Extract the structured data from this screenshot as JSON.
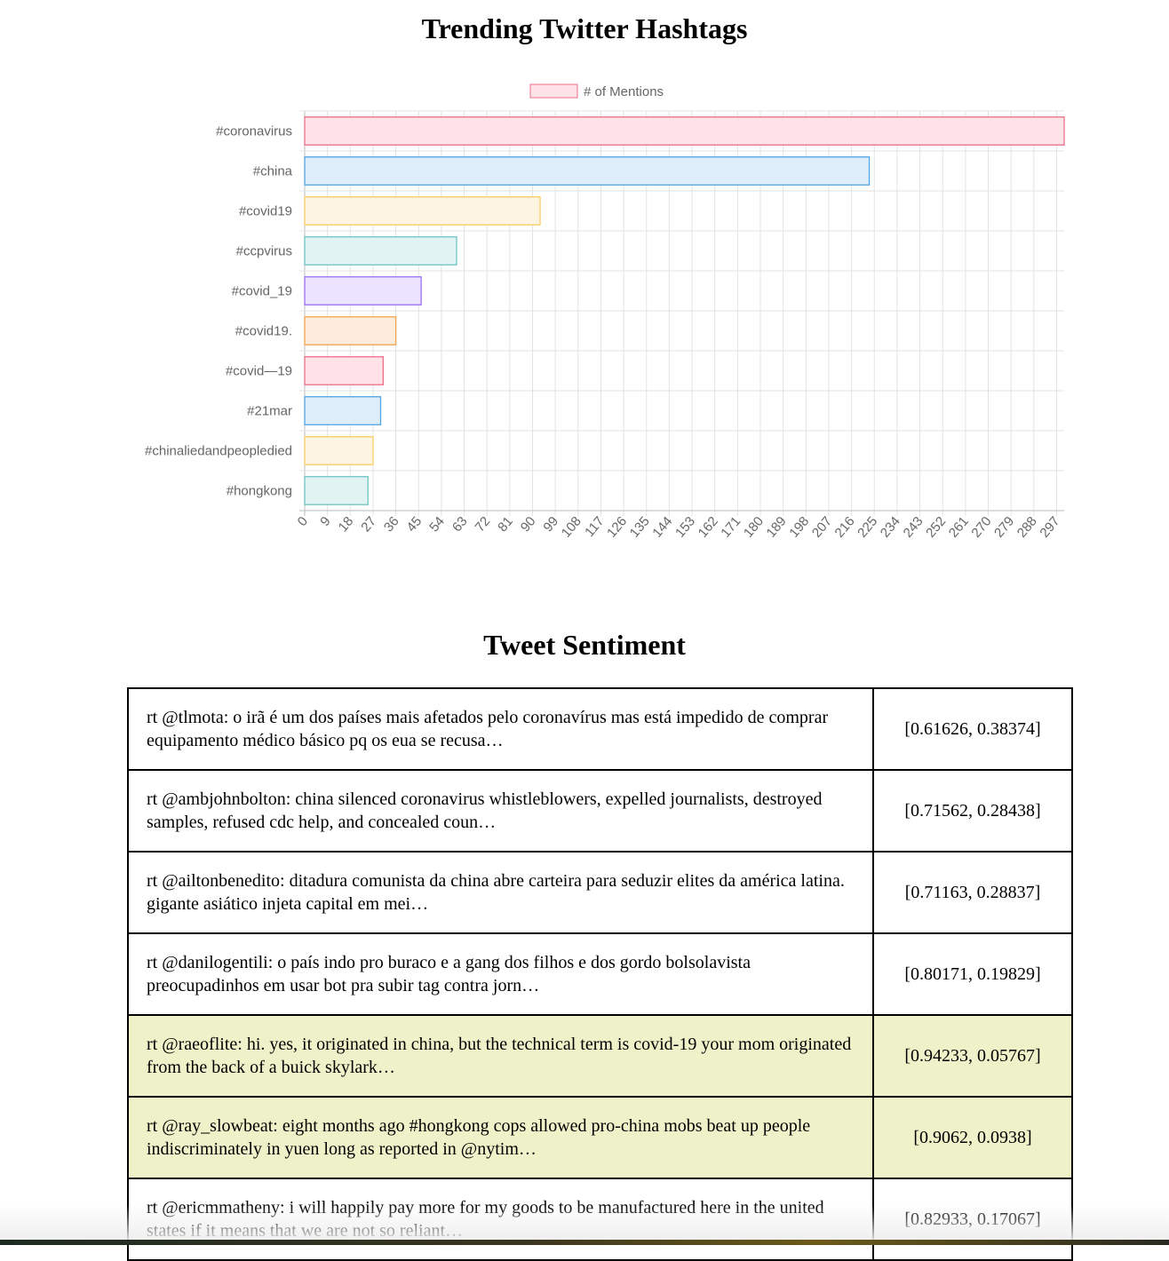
{
  "chart_title": "Trending Twitter Hashtags",
  "chart_data": {
    "type": "bar",
    "orientation": "horizontal",
    "title": "Trending Twitter Hashtags",
    "legend": {
      "label": "# of Mentions",
      "position": "top"
    },
    "categories": [
      "#coronavirus",
      "#china",
      "#covid19",
      "#ccpvirus",
      "#covid_19",
      "#covid19.",
      "#covid—19",
      "#21mar",
      "#chinaliedandpeopledied",
      "#hongkong"
    ],
    "series": [
      {
        "name": "# of Mentions",
        "values": [
          300,
          223,
          93,
          60,
          46,
          36,
          31,
          30,
          27,
          25
        ]
      }
    ],
    "xlim": [
      0,
      300
    ],
    "x_ticks": [
      "0",
      "9",
      "18",
      "27",
      "36",
      "45",
      "54",
      "63",
      "72",
      "81",
      "90",
      "99",
      "108",
      "117",
      "126",
      "135",
      "144",
      "153",
      "162",
      "171",
      "180",
      "189",
      "198",
      "207",
      "216",
      "225",
      "234",
      "243",
      "252",
      "261",
      "270",
      "279",
      "288",
      "297"
    ],
    "grid": true,
    "colors": {
      "fills": [
        "#fde3e8",
        "#deedfa",
        "#fdf4e2",
        "#e1f3f3",
        "#ebe3ff",
        "#fdebdc",
        "#fde3e8",
        "#deedfa",
        "#fdf4e2",
        "#e1f3f3"
      ],
      "strokes": [
        "#ec6f88",
        "#52a4e3",
        "#f9ce63",
        "#6fc3c3",
        "#9b6ff0",
        "#f6a34d",
        "#ec6f88",
        "#52a4e3",
        "#f9ce63",
        "#6fc3c3"
      ]
    }
  },
  "sentiment": {
    "title": "Tweet Sentiment",
    "rows": [
      {
        "text": "rt @tlmota: o irã é um dos países mais afetados pelo coronavírus mas está impedido de comprar equipamento médico básico pq os eua se recusa…",
        "score": "[0.61626, 0.38374]",
        "highlight": false
      },
      {
        "text": "rt @ambjohnbolton: china silenced coronavirus whistleblowers, expelled journalists, destroyed samples, refused cdc help, and concealed coun…",
        "score": "[0.71562, 0.28438]",
        "highlight": false
      },
      {
        "text": "rt @ailtonbenedito: ditadura comunista da china abre carteira para seduzir elites da américa latina. gigante asiático injeta capital em mei…",
        "score": "[0.71163, 0.28837]",
        "highlight": false
      },
      {
        "text": "rt @danilogentili: o país indo pro buraco e a gang dos filhos e dos gordo bolsolavista preocupadinhos em usar bot pra subir tag contra jorn…",
        "score": "[0.80171, 0.19829]",
        "highlight": false
      },
      {
        "text": "rt @raeoflite: hi. yes, it originated in china, but the technical term is covid-19 your mom originated from the back of a buick skylark…",
        "score": "[0.94233, 0.05767]",
        "highlight": true
      },
      {
        "text": "rt @ray_slowbeat: eight months ago #hongkong cops allowed pro-china mobs beat up people indiscriminately in yuen long as reported in @nytim…",
        "score": "[0.9062, 0.0938]",
        "highlight": true
      },
      {
        "text": "rt @ericmmatheny: i will happily pay more for my goods to be manufactured here in the united states if it means that we are not so reliant…",
        "score": "[0.82933, 0.17067]",
        "highlight": false
      }
    ]
  }
}
